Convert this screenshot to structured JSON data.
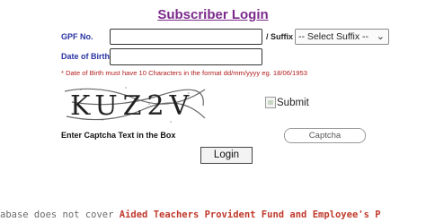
{
  "title": "Subscriber Login",
  "form": {
    "gpf_label": "GPF No.",
    "gpf_value": "",
    "suffix_label": "/ Suffix",
    "suffix_selected": "-- Select Suffix --",
    "dob_label": "Date of Birth",
    "dob_value": "",
    "dob_note": "* Date of Birth must have 10 Characters in the format dd/mm/yyyy eg. 18/06/1953",
    "captcha_text": "KUZ2V",
    "submit_alt": "Submit",
    "captcha_label": "Enter Captcha Text in the Box",
    "captcha_placeholder": "Captcha",
    "login_label": "Login"
  },
  "marquee": {
    "part1": "abase does not cover ",
    "part2": "Aided Teachers Provident Fund and Employee's P"
  },
  "colors": {
    "title": "#7b2a8c",
    "label": "#2a33a3",
    "note": "#b11d1d",
    "marquee_highlight": "#c0392b"
  }
}
